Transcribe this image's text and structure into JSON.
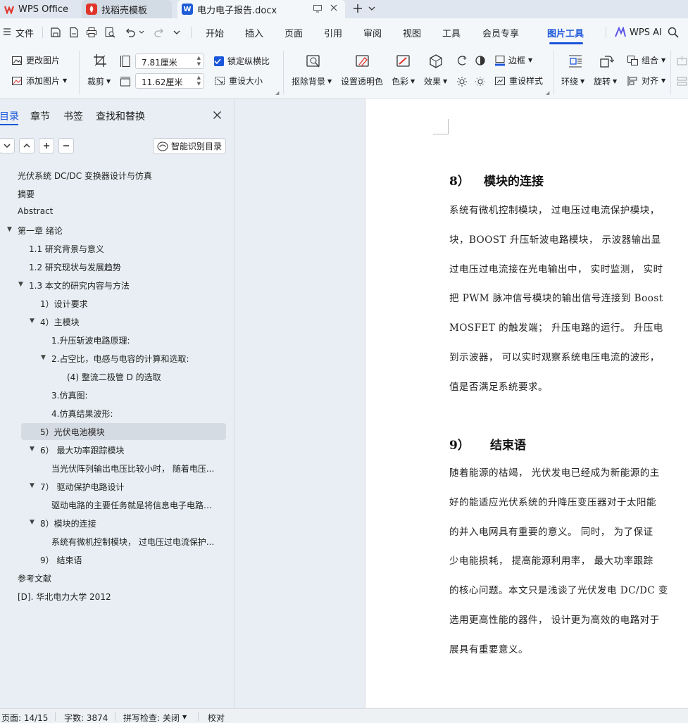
{
  "app": {
    "tabs": [
      {
        "label": "WPS Office",
        "icon": "wps-logo-icon"
      },
      {
        "label": "找稻壳模板",
        "icon": "docer-icon"
      },
      {
        "label": "电力电子报告.docx",
        "icon": "word-doc-icon"
      }
    ]
  },
  "menu": {
    "file": "文件",
    "items": [
      "开始",
      "插入",
      "页面",
      "引用",
      "审阅",
      "视图",
      "工具",
      "会员专享",
      "图片工具"
    ],
    "active": "图片工具",
    "wps_ai": "WPS AI"
  },
  "ribbon": {
    "change_image": "更改图片",
    "add_image": "添加图片",
    "crop": "裁剪",
    "width_value": "7.81厘米",
    "height_value": "11.62厘米",
    "lock_ratio": "锁定纵横比",
    "reset_size": "重设大小",
    "remove_bg": "抠除背景",
    "set_transparent": "设置透明色",
    "color": "色彩",
    "effects": "效果",
    "border": "边框",
    "reset_style": "重设样式",
    "wrap": "环绕",
    "rotate": "旋转",
    "group": "组合",
    "align": "对齐"
  },
  "nav": {
    "tabs": [
      "目录",
      "章节",
      "书签",
      "查找和替换"
    ],
    "active_tab": "目录",
    "smart_toc": "智能识别目录",
    "items": [
      {
        "text": "光伏系统 DC/DC 变换器设计与仿真",
        "level": 0,
        "toggle": false
      },
      {
        "text": "摘要",
        "level": 0,
        "toggle": false
      },
      {
        "text": "Abstract",
        "level": 0,
        "toggle": false
      },
      {
        "text": "第一章 绪论",
        "level": 0,
        "toggle": true
      },
      {
        "text": "1.1 研究背景与意义",
        "level": 1,
        "toggle": false
      },
      {
        "text": "1.2 研究现状与发展趋势",
        "level": 1,
        "toggle": false
      },
      {
        "text": "1.3 本文的研究内容与方法",
        "level": 1,
        "toggle": true
      },
      {
        "text": "1）设计要求",
        "level": 2,
        "toggle": false
      },
      {
        "text": "4）主模块",
        "level": 2,
        "toggle": true
      },
      {
        "text": "1.升压斩波电路原理:",
        "level": 3,
        "toggle": false
      },
      {
        "text": "2.占空比，电感与电容的计算和选取:",
        "level": 3,
        "toggle": true
      },
      {
        "text": "(4)      整流二极管 D 的选取",
        "level": 4,
        "toggle": false
      },
      {
        "text": "3.仿真图:",
        "level": 3,
        "toggle": false
      },
      {
        "text": "4.仿真结果波形:",
        "level": 3,
        "toggle": false
      },
      {
        "text": "5）光伏电池模块",
        "level": 2,
        "toggle": false,
        "selected": true
      },
      {
        "text": "6）  最大功率跟踪模块",
        "level": 2,
        "toggle": true
      },
      {
        "text": "当光伏阵列输出电压比较小时，  随着电压...",
        "level": 3,
        "toggle": false
      },
      {
        "text": "7）  驱动保护电路设计",
        "level": 2,
        "toggle": true
      },
      {
        "text": "驱动电路的主要任务就是将信息电子电路传...",
        "level": 3,
        "toggle": false
      },
      {
        "text": "8）模块的连接",
        "level": 2,
        "toggle": true
      },
      {
        "text": "系统有微机控制模块，  过电压过电流保护...",
        "level": 3,
        "toggle": false
      },
      {
        "text": "9）  结束语",
        "level": 2,
        "toggle": false
      },
      {
        "text": "参考文献",
        "level": 0,
        "toggle": false
      },
      {
        "text": "[D]. 华北电力大学 2012",
        "level": 0,
        "toggle": false
      }
    ]
  },
  "document": {
    "section8": {
      "num": "8）",
      "title": "模块的连接",
      "lines": [
        "系统有微机控制模块，  过电压过电流保护模块，",
        "块，BOOST 升压斩波电路模块，  示波器输出显",
        "过电压过电流接在光电输出中，  实时监测，  实时",
        "把 PWM 脉冲信号模块的输出信号连接到 Boost",
        "MOSFET 的触发端；  升压电路的运行。  升压电",
        "到示波器，  可以实时观察系统电压电流的波形，",
        "值是否满足系统要求。"
      ]
    },
    "section9": {
      "num": "9）",
      "title": "结束语",
      "lines": [
        "随着能源的枯竭，  光伏发电已经成为新能源的主",
        "好的能适应光伏系统的升降压变压器对于太阳能",
        "的并入电网具有重要的意义。  同时，  为了保证",
        "少电能损耗，  提高能源利用率，  最大功率跟踪",
        "的核心问题。本文只是浅谈了光伏发电 DC/DC 变",
        "选用更高性能的器件，  设计更为高效的电路对于",
        "展具有重要意义。"
      ]
    }
  },
  "status": {
    "page": "页面: 14/15",
    "words": "字数: 3874",
    "spell": "拼写检查: 关闭",
    "proof": "校对"
  },
  "colors": {
    "accent": "#1a56db",
    "wps_red": "#e0352b",
    "selected_row": "#d5dbe2"
  }
}
